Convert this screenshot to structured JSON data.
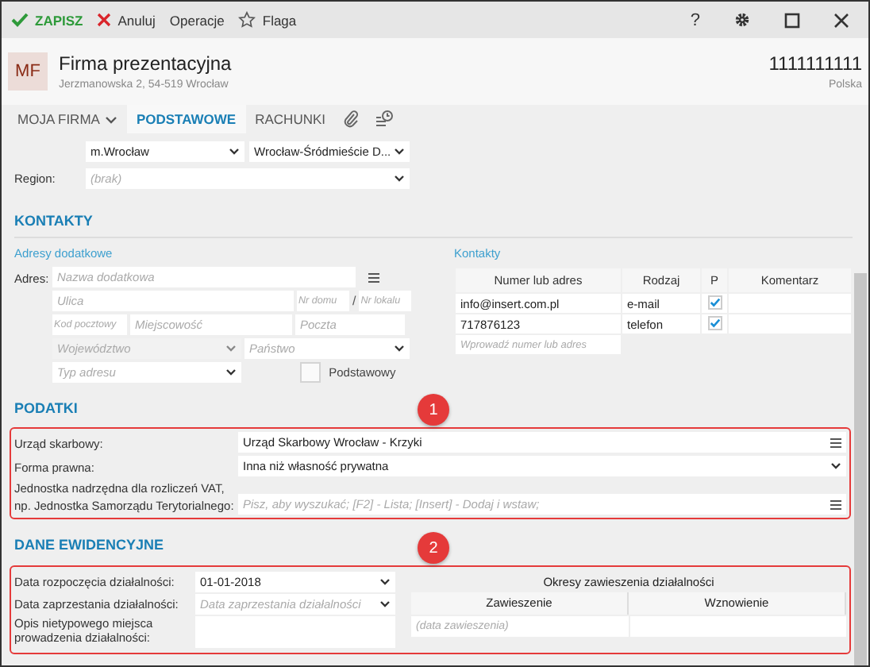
{
  "toolbar": {
    "actions": [
      {
        "kind": "save",
        "label": "ZAPISZ"
      },
      {
        "kind": "cancel",
        "label": "Anuluj"
      },
      {
        "kind": "menu",
        "label": "Operacje"
      },
      {
        "kind": "flag",
        "label": "Flaga"
      }
    ],
    "help": "?"
  },
  "header": {
    "initials": "MF",
    "name": "Firma prezentacyjna",
    "address": "Jerzmanowska 2, 54-519 Wrocław",
    "nip": "1111111111",
    "country": "Polska"
  },
  "tabs": [
    {
      "kind": "dropdown",
      "label": "MOJA FIRMA",
      "selected": false
    },
    {
      "kind": "text",
      "label": "PODSTAWOWE",
      "selected": true
    },
    {
      "kind": "text",
      "label": "RACHUNKI",
      "selected": false
    },
    {
      "kind": "attachment",
      "selected": false
    },
    {
      "kind": "history",
      "selected": false
    }
  ],
  "location": {
    "commune": "m.Wrocław",
    "district": "Wrocław-Śródmieście  D...",
    "region_label": "Region:",
    "region_placeholder": "(brak)"
  },
  "kontakty": {
    "title": "KONTAKTY",
    "addresses": {
      "title": "Adresy dodatkowe",
      "label": "Adres:",
      "name_placeholder": "Nazwa dodatkowa",
      "street": "Ulica",
      "house": "Nr domu",
      "separator": "/",
      "flat": "Nr lokalu",
      "postal": "Kod pocztowy",
      "city": "Miejscowość",
      "post": "Poczta",
      "province": "Województwo",
      "country": "Państwo",
      "type": "Typ adresu",
      "primary_label": "Podstawowy",
      "primary": false
    },
    "contacts": {
      "title": "Kontakty",
      "columns": [
        "Numer lub adres",
        "Rodzaj",
        "P",
        "Komentarz"
      ],
      "rows": [
        {
          "value": "info@insert.com.pl",
          "type": "e-mail",
          "primary": true
        },
        {
          "value": "717876123",
          "type": "telefon",
          "primary": true
        }
      ],
      "new_placeholder": "Wprowadź numer lub adres"
    }
  },
  "podatki": {
    "title": "PODATKI",
    "badge": "1",
    "rows": [
      {
        "kind": "lookup",
        "label": "Urząd skarbowy:",
        "value": "Urząd Skarbowy Wrocław - Krzyki"
      },
      {
        "kind": "select",
        "label": "Forma prawna:",
        "value": "Inna niż własność prywatna"
      },
      {
        "kind": "lookup",
        "label": "Jednostka nadrzędna dla rozliczeń VAT, np. Jednostka Samorządu Terytorialnego:",
        "placeholder": "Pisz, aby wyszukać; [F2] - Lista; [Insert] - Dodaj i wstaw;"
      }
    ]
  },
  "ewidencja": {
    "title": "DANE EWIDENCYJNE",
    "badge": "2",
    "rows": [
      {
        "kind": "date",
        "label": "Data rozpoczęcia działalności:",
        "value": "01-01-2018"
      },
      {
        "kind": "date",
        "label": "Data zaprzestania działalności:",
        "placeholder": "Data zaprzestania działalności"
      },
      {
        "kind": "text",
        "label": "Opis nietypowego miejsca prowadzenia działalności:"
      }
    ],
    "suspensions": {
      "title": "Okresy zawieszenia działalności",
      "columns": [
        "Zawieszenie",
        "Wznowienie"
      ],
      "placeholder": "(data zawieszenia)"
    }
  }
}
